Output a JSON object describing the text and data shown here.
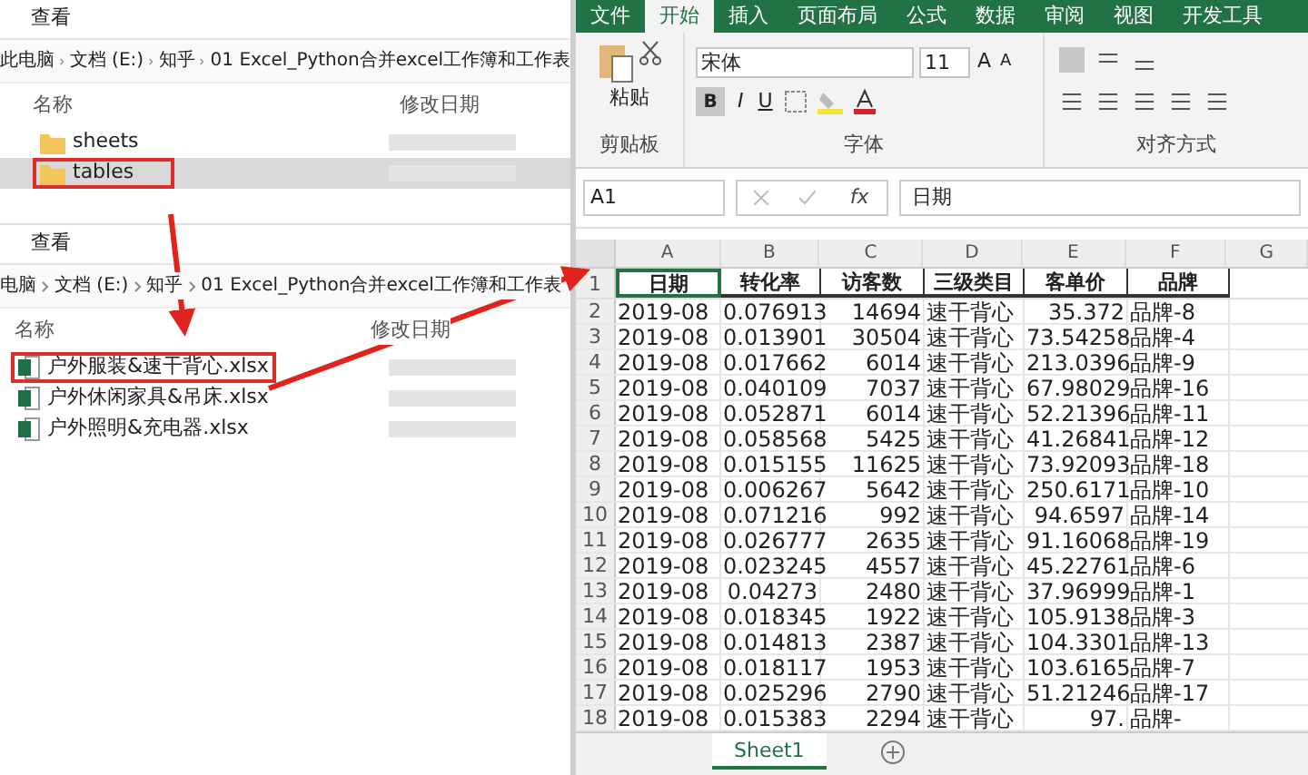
{
  "explorer_top": {
    "menu": "查看",
    "breadcrumb": [
      "此电脑",
      "文档 (E:)",
      "知乎",
      "01 Excel_Python合并excel工作簿和工作表"
    ],
    "columns": [
      "名称",
      "修改日期"
    ],
    "items": [
      {
        "name": "sheets",
        "selected": false,
        "highlighted": false
      },
      {
        "name": "tables",
        "selected": true,
        "highlighted": true
      }
    ]
  },
  "explorer_bottom": {
    "menu": "查看",
    "breadcrumb": [
      "电脑",
      "文档 (E:)",
      "知乎",
      "01 Excel_Python合并excel工作簿和工作表"
    ],
    "columns": [
      "名称",
      "修改日期"
    ],
    "items": [
      {
        "name": "户外服装&速干背心.xlsx",
        "highlighted": true
      },
      {
        "name": "户外休闲家具&吊床.xlsx",
        "highlighted": false
      },
      {
        "name": "户外照明&充电器.xlsx",
        "highlighted": false
      }
    ]
  },
  "excel": {
    "tabs": [
      {
        "label": "文件",
        "selected": false
      },
      {
        "label": "开始",
        "selected": true
      },
      {
        "label": "插入",
        "selected": false
      },
      {
        "label": "页面布局",
        "selected": false
      },
      {
        "label": "公式",
        "selected": false
      },
      {
        "label": "数据",
        "selected": false
      },
      {
        "label": "审阅",
        "selected": false
      },
      {
        "label": "视图",
        "selected": false
      },
      {
        "label": "开发工具",
        "selected": false
      }
    ],
    "ribbon": {
      "paste": "粘贴",
      "font_name": "宋体",
      "font_size": "11",
      "size_buttons": [
        "A",
        "A"
      ],
      "bold": {
        "label": "B",
        "on": true
      },
      "italic": "I",
      "underline": "U",
      "groups": [
        "剪贴板",
        "字体",
        "对齐方式"
      ]
    },
    "name_box": "A1",
    "function_label": "fx",
    "formula": "日期",
    "columns": [
      "A",
      "B",
      "C",
      "D",
      "E",
      "F",
      "G"
    ],
    "header": {
      "num": "1",
      "cells": [
        "日期",
        "转化率",
        "访客数",
        "三级类目",
        "客单价",
        "品牌"
      ]
    },
    "rows": [
      {
        "num": "2",
        "cells": [
          "2019-08",
          "0.076913",
          "14694",
          "速干背心",
          "35.372",
          "品牌-8"
        ]
      },
      {
        "num": "3",
        "cells": [
          "2019-08",
          "0.013901",
          "30504",
          "速干背心",
          "73.54258",
          "品牌-4"
        ]
      },
      {
        "num": "4",
        "cells": [
          "2019-08",
          "0.017662",
          "6014",
          "速干背心",
          "213.0396",
          "品牌-9"
        ]
      },
      {
        "num": "5",
        "cells": [
          "2019-08",
          "0.040109",
          "7037",
          "速干背心",
          "67.98029",
          "品牌-16"
        ]
      },
      {
        "num": "6",
        "cells": [
          "2019-08",
          "0.052871",
          "6014",
          "速干背心",
          "52.21396",
          "品牌-11"
        ]
      },
      {
        "num": "7",
        "cells": [
          "2019-08",
          "0.058568",
          "5425",
          "速干背心",
          "41.26841",
          "品牌-12"
        ]
      },
      {
        "num": "8",
        "cells": [
          "2019-08",
          "0.015155",
          "11625",
          "速干背心",
          "73.92093",
          "品牌-18"
        ]
      },
      {
        "num": "9",
        "cells": [
          "2019-08",
          "0.006267",
          "5642",
          "速干背心",
          "250.6171",
          "品牌-10"
        ]
      },
      {
        "num": "10",
        "cells": [
          "2019-08",
          "0.071216",
          "992",
          "速干背心",
          "94.6597",
          "品牌-14"
        ]
      },
      {
        "num": "11",
        "cells": [
          "2019-08",
          "0.026777",
          "2635",
          "速干背心",
          "91.16068",
          "品牌-19"
        ]
      },
      {
        "num": "12",
        "cells": [
          "2019-08",
          "0.023245",
          "4557",
          "速干背心",
          "45.22761",
          "品牌-6"
        ]
      },
      {
        "num": "13",
        "cells": [
          "2019-08",
          "0.04273",
          "2480",
          "速干背心",
          "37.96999",
          "品牌-1"
        ]
      },
      {
        "num": "14",
        "cells": [
          "2019-08",
          "0.018345",
          "1922",
          "速干背心",
          "105.9138",
          "品牌-3"
        ]
      },
      {
        "num": "15",
        "cells": [
          "2019-08",
          "0.014813",
          "2387",
          "速干背心",
          "104.3301",
          "品牌-13"
        ]
      },
      {
        "num": "16",
        "cells": [
          "2019-08",
          "0.018117",
          "1953",
          "速干背心",
          "103.6165",
          "品牌-7"
        ]
      },
      {
        "num": "17",
        "cells": [
          "2019-08",
          "0.025296",
          "2790",
          "速干背心",
          "51.21246",
          "品牌-17"
        ]
      },
      {
        "num": "18",
        "cells": [
          "2019-08",
          "0.015383",
          "2294",
          "速干背心",
          "97.",
          "品牌-"
        ]
      }
    ],
    "sheets": [
      {
        "label": "Sheet1",
        "selected": true
      }
    ]
  }
}
